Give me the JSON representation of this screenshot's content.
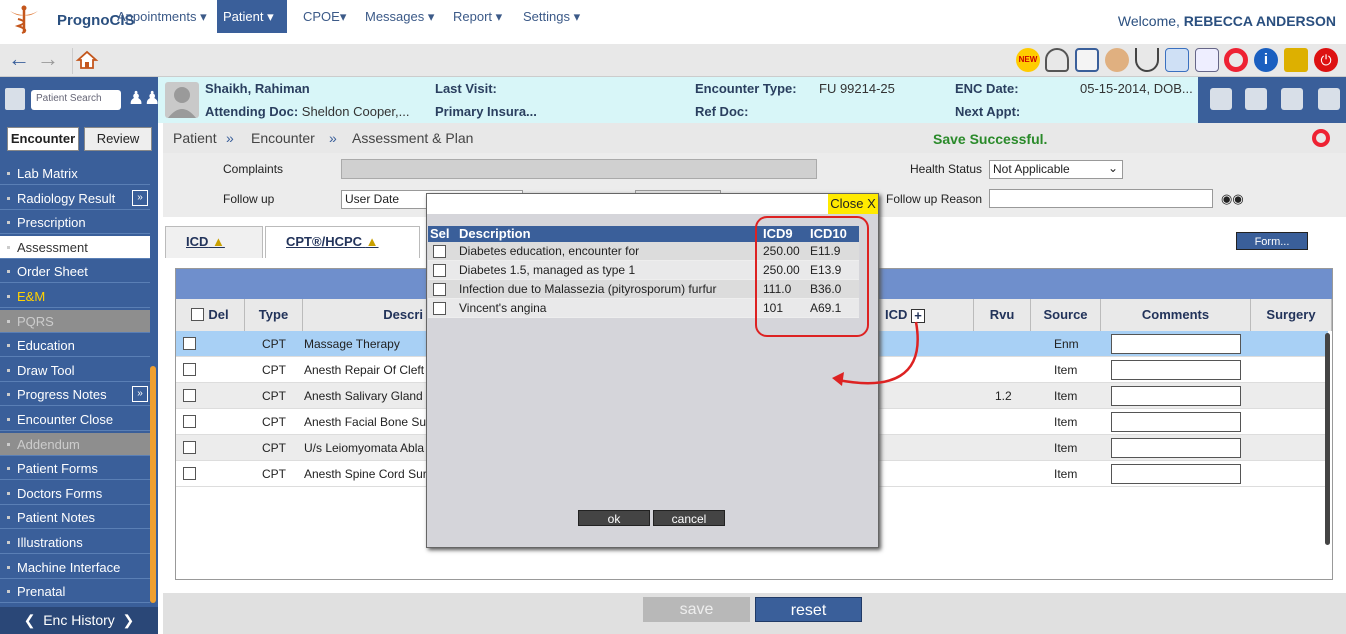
{
  "app": {
    "title": "PrognoCIS",
    "welcome_prefix": "Welcome,",
    "user": "REBECCA ANDERSON"
  },
  "menu": {
    "items": [
      {
        "label": "Appointments",
        "active": false
      },
      {
        "label": "Patient",
        "active": true
      },
      {
        "label": "CPOE",
        "active": false
      },
      {
        "label": "Messages",
        "active": false
      },
      {
        "label": "Report",
        "active": false
      },
      {
        "label": "Settings",
        "active": false
      }
    ],
    "toolbar_icons": [
      "new-icon",
      "dashboard-gauge-icon",
      "calendar-clock-icon",
      "user-icon",
      "stethoscope-icon",
      "mail-icon",
      "documents-icon",
      "lifebuoy-icon",
      "info-icon",
      "lock-icon",
      "power-icon"
    ]
  },
  "patient": {
    "search_placeholder": "Patient Search",
    "name": "Shaikh, Rahiman",
    "attending_label": "Attending Doc:",
    "attending": "Sheldon Cooper,...",
    "last_visit_label": "Last Visit:",
    "last_visit": "",
    "primary_ins": "Primary Insura...",
    "encounter_type_label": "Encounter Type:",
    "encounter_type": "FU 99214-25",
    "ref_doc_label": "Ref Doc:",
    "enc_date_label": "ENC Date:",
    "enc_date": "05-15-2014, DOB...",
    "next_appt_label": "Next Appt:"
  },
  "sidebar": {
    "tabs": [
      "Encounter",
      "Review"
    ],
    "items": [
      {
        "label": "Lab Matrix",
        "style": "normal",
        "arrow": false
      },
      {
        "label": "Radiology Result",
        "style": "normal",
        "arrow": true
      },
      {
        "label": "Prescription",
        "style": "normal",
        "arrow": false
      },
      {
        "label": "Assessment",
        "style": "sel",
        "arrow": false
      },
      {
        "label": "Order Sheet",
        "style": "normal",
        "arrow": false
      },
      {
        "label": "E&M",
        "style": "gold",
        "arrow": false
      },
      {
        "label": "PQRS",
        "style": "dim",
        "arrow": false
      },
      {
        "label": "Education",
        "style": "normal",
        "arrow": false
      },
      {
        "label": "Draw Tool",
        "style": "normal",
        "arrow": false
      },
      {
        "label": "Progress Notes",
        "style": "normal",
        "arrow": true
      },
      {
        "label": "Encounter Close",
        "style": "normal",
        "arrow": false
      },
      {
        "label": "Addendum",
        "style": "dim",
        "arrow": false
      },
      {
        "label": "Patient Forms",
        "style": "normal",
        "arrow": false
      },
      {
        "label": "Doctors Forms",
        "style": "normal",
        "arrow": false
      },
      {
        "label": "Patient Notes",
        "style": "normal",
        "arrow": false
      },
      {
        "label": "Illustrations",
        "style": "normal",
        "arrow": false
      },
      {
        "label": "Machine Interface",
        "style": "normal",
        "arrow": false
      },
      {
        "label": "Prenatal",
        "style": "normal",
        "arrow": false
      }
    ],
    "enc_history": "Enc History"
  },
  "breadcrumb": {
    "items": [
      "Patient",
      "Encounter",
      "Assessment & Plan"
    ],
    "separator": "»",
    "status": "Save Successful."
  },
  "form": {
    "complaints_label": "Complaints",
    "follow_up_label": "Follow up",
    "follow_up_value": "User Date",
    "health_status_label": "Health Status",
    "health_status_value": "Not Applicable",
    "follow_up_reason_label": "Follow up Reason"
  },
  "tabs": {
    "icd": "ICD",
    "cpt": "CPT®/HCPC",
    "form_button": "Form..."
  },
  "grid": {
    "columns": {
      "del": "Del",
      "type": "Type",
      "desc": "Descri",
      "icd": "ICD",
      "rvu": "Rvu",
      "source": "Source",
      "comments": "Comments",
      "surgery": "Surgery"
    },
    "rows": [
      {
        "type": "CPT",
        "desc": "Massage Therapy",
        "rvu": "",
        "source": "Enm"
      },
      {
        "type": "CPT",
        "desc": "Anesth Repair Of Cleft",
        "rvu": "",
        "source": "Item"
      },
      {
        "type": "CPT",
        "desc": "Anesth Salivary Gland",
        "rvu": "1.2",
        "source": "Item"
      },
      {
        "type": "CPT",
        "desc": "Anesth Facial Bone Su",
        "rvu": "",
        "source": "Item"
      },
      {
        "type": "CPT",
        "desc": "U/s Leiomyomata Abla",
        "rvu": "",
        "source": "Item"
      },
      {
        "type": "CPT",
        "desc": "Anesth Spine Cord Sur",
        "rvu": "",
        "source": "Item"
      }
    ]
  },
  "dialog": {
    "close": "Close X",
    "headers": {
      "sel": "Sel",
      "desc": "Description",
      "icd9": "ICD9",
      "icd10": "ICD10"
    },
    "rows": [
      {
        "desc": "Diabetes education, encounter for",
        "icd9": "250.00",
        "icd10": "E11.9"
      },
      {
        "desc": "Diabetes 1.5, managed as type 1",
        "icd9": "250.00",
        "icd10": "E13.9"
      },
      {
        "desc": "Infection due to Malassezia (pityrosporum) furfur",
        "icd9": "111.0",
        "icd10": "B36.0"
      },
      {
        "desc": "Vincent's angina",
        "icd9": "101",
        "icd10": "A69.1"
      }
    ],
    "ok": "ok",
    "cancel": "cancel"
  },
  "bottom": {
    "save": "save",
    "reset": "reset"
  },
  "colors": {
    "brand": "#3a5f9a",
    "highlight_row": "#a8d0f5",
    "save_success": "#2a8a2a",
    "annotation": "#dd2222",
    "close_bg": "#ffea00"
  }
}
